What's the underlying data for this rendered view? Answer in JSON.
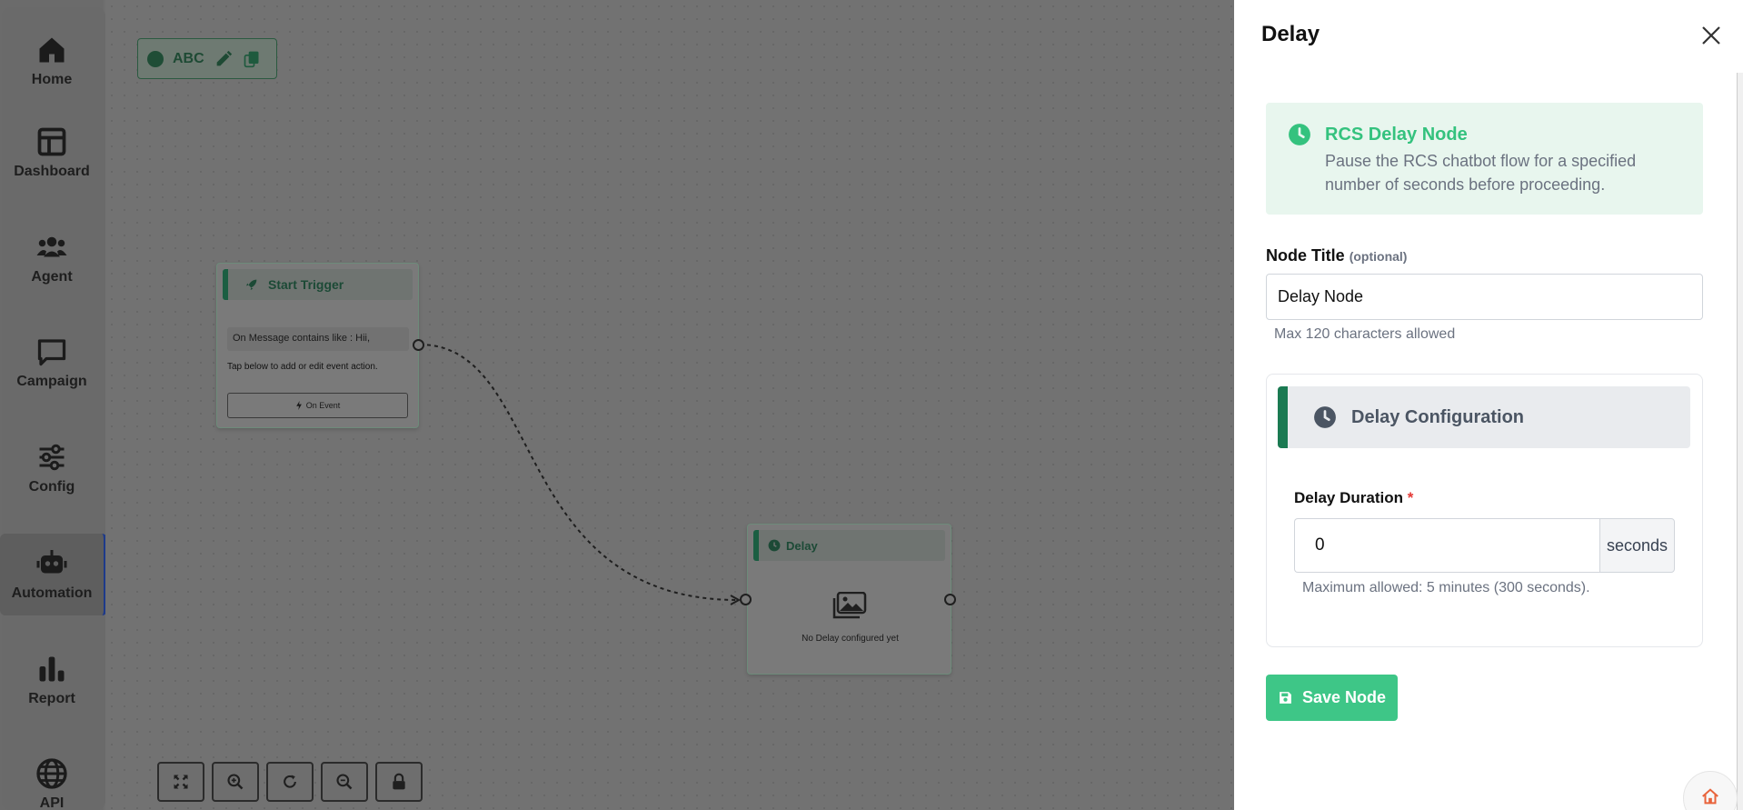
{
  "sidebar": {
    "items": [
      {
        "label": "Home",
        "icon": "home-icon"
      },
      {
        "label": "Dashboard",
        "icon": "dashboard-icon"
      },
      {
        "label": "Agent",
        "icon": "agent-icon"
      },
      {
        "label": "Campaign",
        "icon": "campaign-icon"
      },
      {
        "label": "Config",
        "icon": "config-icon"
      },
      {
        "label": "Automation",
        "icon": "robot-icon",
        "active": true
      },
      {
        "label": "Report",
        "icon": "report-icon"
      },
      {
        "label": "API",
        "icon": "globe-icon"
      }
    ]
  },
  "flow": {
    "name": "ABC"
  },
  "canvas": {
    "start_node": {
      "title": "Start Trigger",
      "message": "On Message contains like : Hii,",
      "instruction": "Tap below to add or edit event action.",
      "event_button": "On Event"
    },
    "delay_node": {
      "title": "Delay",
      "empty_text": "No Delay configured yet"
    }
  },
  "panel": {
    "title": "Delay",
    "info": {
      "title": "RCS Delay Node",
      "description": "Pause the RCS chatbot flow for a specified number of seconds before proceeding."
    },
    "node_title": {
      "label": "Node Title",
      "optional": "(optional)",
      "value": "Delay Node",
      "hint": "Max 120 characters allowed"
    },
    "config": {
      "heading": "Delay Configuration",
      "duration_label": "Delay Duration",
      "required_mark": "*",
      "duration_value": "0",
      "unit": "seconds",
      "hint": "Maximum allowed: 5 minutes (300 seconds)."
    },
    "save_label": "Save Node"
  },
  "colors": {
    "accent_green": "#3ec687",
    "dark_green": "#1b7a52",
    "info_bg": "#e8f6ee",
    "required": "#e53935"
  }
}
